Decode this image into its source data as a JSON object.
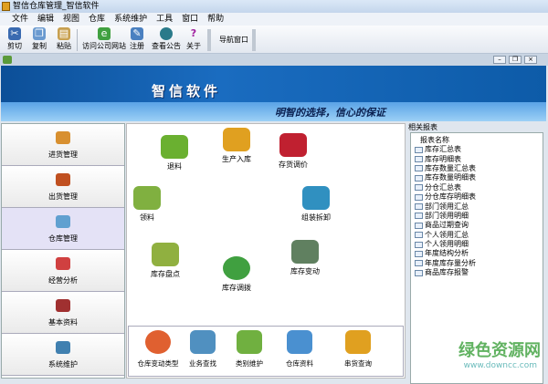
{
  "window": {
    "title": "智信仓库管理_智信软件"
  },
  "menu": [
    "文件",
    "编辑",
    "视图",
    "仓库",
    "系统维护",
    "工具",
    "窗口",
    "帮助"
  ],
  "toolbar": [
    {
      "label": "剪切",
      "icon": "scissors-icon"
    },
    {
      "label": "复制",
      "icon": "copy-icon"
    },
    {
      "label": "粘贴",
      "icon": "paste-icon"
    },
    {
      "label": "访问公司网站",
      "icon": "ie-icon"
    },
    {
      "label": "注册",
      "icon": "register-icon"
    },
    {
      "label": "查看公告",
      "icon": "globe-icon"
    },
    {
      "label": "关于",
      "icon": "help-icon"
    }
  ],
  "nav_toolbar": {
    "label": "导航窗口"
  },
  "banner": {
    "brand": "智信软件",
    "slogan": "明智的选择，信心的保证"
  },
  "sidebar": [
    {
      "label": "进货管理",
      "color": "#d89030"
    },
    {
      "label": "出货管理",
      "color": "#c05020"
    },
    {
      "label": "仓库管理",
      "color": "#60a0d0",
      "selected": true
    },
    {
      "label": "经营分析",
      "color": "#d04040"
    },
    {
      "label": "基本资料",
      "color": "#a03030"
    },
    {
      "label": "系统维护",
      "color": "#4080b0"
    }
  ],
  "main_items": [
    {
      "label": "退料",
      "color": "#6ab030"
    },
    {
      "label": "生产入库",
      "color": "#e0a020"
    },
    {
      "label": "存货调价",
      "color": "#c02030"
    },
    {
      "label": "领料",
      "color": "#80b040"
    },
    {
      "label": "组装拆卸",
      "color": "#3090c0"
    },
    {
      "label": "库存盘点",
      "color": "#90b040"
    },
    {
      "label": "库存调拨",
      "color": "#40a040"
    },
    {
      "label": "库存变动",
      "color": "#608060"
    }
  ],
  "bottom_items": [
    {
      "label": "仓库变动类型",
      "color": "#e06030"
    },
    {
      "label": "业务查找",
      "color": "#5090c0"
    },
    {
      "label": "类别维护",
      "color": "#70b040"
    },
    {
      "label": "仓库资料",
      "color": "#4a90d0"
    },
    {
      "label": "串货查询",
      "color": "#e0a020"
    }
  ],
  "reports": {
    "title": "相关报表",
    "header": "报表名称",
    "items": [
      "库存汇总表",
      "库存明细表",
      "库存数量汇总表",
      "库存数量明细表",
      "分仓汇总表",
      "分仓库存明细表",
      "部门领用汇总",
      "部门领用明细",
      "商品过期查询",
      "个人领用汇总",
      "个人领用明细",
      "年度结构分析",
      "年度库存量分析",
      "商品库存报警"
    ]
  },
  "watermark": {
    "text": "绿色资源网",
    "url": "www.downcc.com"
  }
}
